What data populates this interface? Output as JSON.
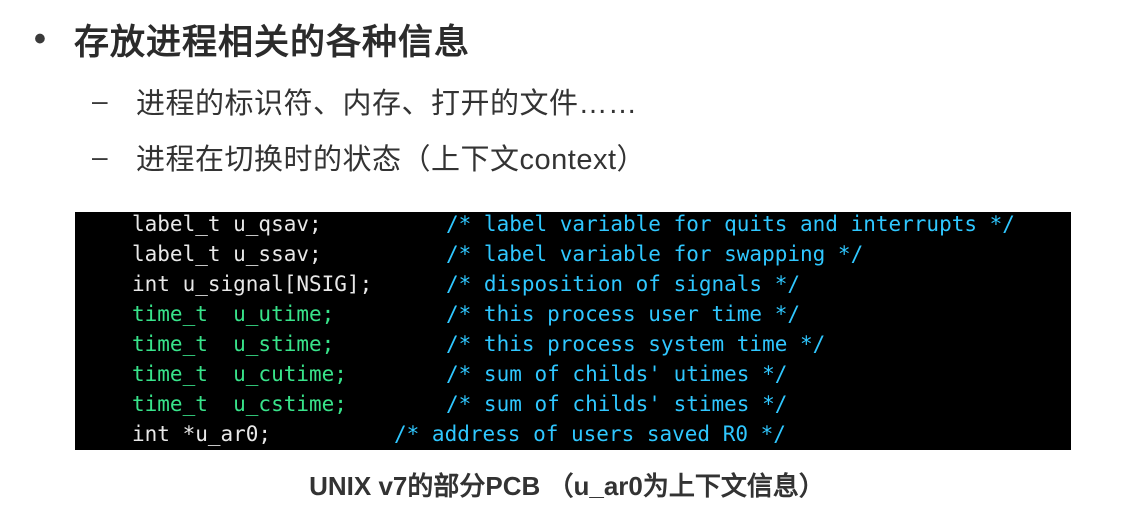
{
  "slide": {
    "bullet_symbol": "•",
    "heading": "存放进程相关的各种信息",
    "sub_bullets": [
      {
        "dash": "–",
        "text": "进程的标识符、内存、打开的文件……"
      },
      {
        "dash": "–",
        "text": "进程在切换时的状态（上下文context）"
      }
    ]
  },
  "code": {
    "colors": {
      "background": "#000000",
      "type_white": "#e8e8e8",
      "type_green": "#38e38a",
      "comment": "#2fc7ff"
    },
    "lines": [
      {
        "decl": "label_t u_qsav;",
        "comment": "/* label variable for quits and interrupts */"
      },
      {
        "decl": "label_t u_ssav;",
        "comment": "/* label variable for swapping */"
      },
      {
        "decl": "int u_signal[NSIG];",
        "comment": "/* disposition of signals */"
      },
      {
        "decl": "time_t  u_utime;",
        "comment": "/* this process user time */"
      },
      {
        "decl": "time_t  u_stime;",
        "comment": "/* this process system time */"
      },
      {
        "decl": "time_t  u_cutime;",
        "comment": "/* sum of childs' utimes */"
      },
      {
        "decl": "time_t  u_cstime;",
        "comment": "/* sum of childs' stimes */"
      },
      {
        "decl": "int *u_ar0;",
        "comment": "/* address of users saved R0 */"
      }
    ]
  },
  "caption": "UNIX v7的部分PCB （u_ar0为上下文信息）"
}
